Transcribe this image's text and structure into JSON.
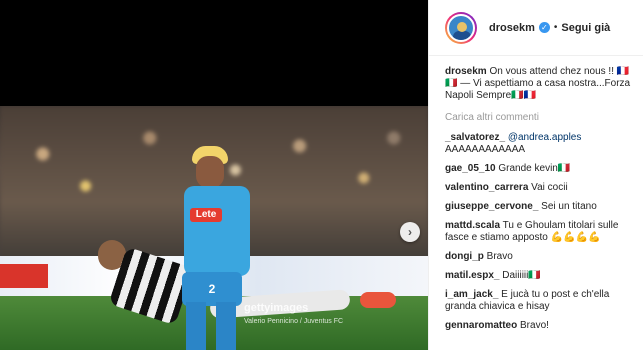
{
  "post": {
    "username": "drosekm",
    "dot": "•",
    "follow_label": "Segui già",
    "caption_user": "drosekm",
    "caption_text": "On vous attend chez nous !! 🇫🇷🇮🇹 — Vi aspettiamo a casa nostra...Forza Napoli Sempre🇮🇹🇫🇷",
    "load_more": "Carica altri commenti",
    "watermark": "gettyimages",
    "watermark_credit": "Valerio Pennicino / Juventus FC",
    "shirt_sponsor": "Lete",
    "shirt_number": "2"
  },
  "comments": [
    {
      "user": "_salvatorez_",
      "text": "@andrea.apples",
      "mention": true
    },
    {
      "user": "",
      "text": "AAAAAAAAAAAA"
    },
    {
      "user": "gae_05_10",
      "text": "Grande kevin🇮🇹"
    },
    {
      "user": "valentino_carrera",
      "text": "Vai cocii"
    },
    {
      "user": "giuseppe_cervone_",
      "text": "Sei un titano"
    },
    {
      "user": "mattd.scala",
      "text": "Tu e Ghoulam titolari sulle fasce e stiamo apposto 💪💪💪💪"
    },
    {
      "user": "dongi_p",
      "text": "Bravo"
    },
    {
      "user": "matil.espx_",
      "text": "Daiiiiii🇮🇹"
    },
    {
      "user": "i_am_jack_",
      "text": "E jucà tu o post e ch'ella granda chiavica e hisay"
    },
    {
      "user": "gennaromatteo",
      "text": "Bravo!"
    }
  ],
  "colors": {
    "accent_blue": "#3897f0",
    "napoli_blue": "#3aa6df"
  },
  "icons": {
    "verified": "verified-badge-icon",
    "next": "chevron-right-icon"
  }
}
